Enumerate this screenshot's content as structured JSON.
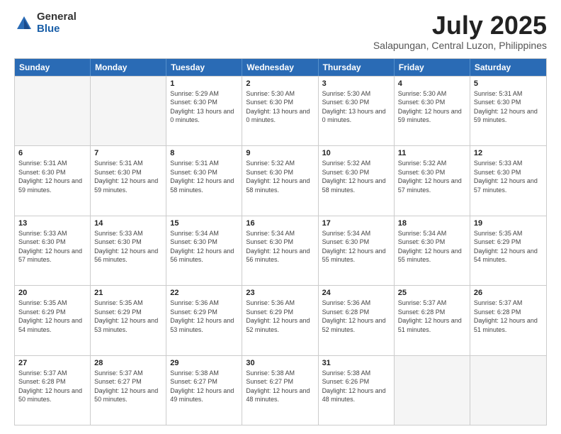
{
  "logo": {
    "general": "General",
    "blue": "Blue"
  },
  "title": "July 2025",
  "subtitle": "Salapungan, Central Luzon, Philippines",
  "weekdays": [
    "Sunday",
    "Monday",
    "Tuesday",
    "Wednesday",
    "Thursday",
    "Friday",
    "Saturday"
  ],
  "weeks": [
    [
      {
        "day": "",
        "empty": true
      },
      {
        "day": "",
        "empty": true
      },
      {
        "day": "1",
        "sunrise": "Sunrise: 5:29 AM",
        "sunset": "Sunset: 6:30 PM",
        "daylight": "Daylight: 13 hours and 0 minutes."
      },
      {
        "day": "2",
        "sunrise": "Sunrise: 5:30 AM",
        "sunset": "Sunset: 6:30 PM",
        "daylight": "Daylight: 13 hours and 0 minutes."
      },
      {
        "day": "3",
        "sunrise": "Sunrise: 5:30 AM",
        "sunset": "Sunset: 6:30 PM",
        "daylight": "Daylight: 13 hours and 0 minutes."
      },
      {
        "day": "4",
        "sunrise": "Sunrise: 5:30 AM",
        "sunset": "Sunset: 6:30 PM",
        "daylight": "Daylight: 12 hours and 59 minutes."
      },
      {
        "day": "5",
        "sunrise": "Sunrise: 5:31 AM",
        "sunset": "Sunset: 6:30 PM",
        "daylight": "Daylight: 12 hours and 59 minutes."
      }
    ],
    [
      {
        "day": "6",
        "sunrise": "Sunrise: 5:31 AM",
        "sunset": "Sunset: 6:30 PM",
        "daylight": "Daylight: 12 hours and 59 minutes."
      },
      {
        "day": "7",
        "sunrise": "Sunrise: 5:31 AM",
        "sunset": "Sunset: 6:30 PM",
        "daylight": "Daylight: 12 hours and 59 minutes."
      },
      {
        "day": "8",
        "sunrise": "Sunrise: 5:31 AM",
        "sunset": "Sunset: 6:30 PM",
        "daylight": "Daylight: 12 hours and 58 minutes."
      },
      {
        "day": "9",
        "sunrise": "Sunrise: 5:32 AM",
        "sunset": "Sunset: 6:30 PM",
        "daylight": "Daylight: 12 hours and 58 minutes."
      },
      {
        "day": "10",
        "sunrise": "Sunrise: 5:32 AM",
        "sunset": "Sunset: 6:30 PM",
        "daylight": "Daylight: 12 hours and 58 minutes."
      },
      {
        "day": "11",
        "sunrise": "Sunrise: 5:32 AM",
        "sunset": "Sunset: 6:30 PM",
        "daylight": "Daylight: 12 hours and 57 minutes."
      },
      {
        "day": "12",
        "sunrise": "Sunrise: 5:33 AM",
        "sunset": "Sunset: 6:30 PM",
        "daylight": "Daylight: 12 hours and 57 minutes."
      }
    ],
    [
      {
        "day": "13",
        "sunrise": "Sunrise: 5:33 AM",
        "sunset": "Sunset: 6:30 PM",
        "daylight": "Daylight: 12 hours and 57 minutes."
      },
      {
        "day": "14",
        "sunrise": "Sunrise: 5:33 AM",
        "sunset": "Sunset: 6:30 PM",
        "daylight": "Daylight: 12 hours and 56 minutes."
      },
      {
        "day": "15",
        "sunrise": "Sunrise: 5:34 AM",
        "sunset": "Sunset: 6:30 PM",
        "daylight": "Daylight: 12 hours and 56 minutes."
      },
      {
        "day": "16",
        "sunrise": "Sunrise: 5:34 AM",
        "sunset": "Sunset: 6:30 PM",
        "daylight": "Daylight: 12 hours and 56 minutes."
      },
      {
        "day": "17",
        "sunrise": "Sunrise: 5:34 AM",
        "sunset": "Sunset: 6:30 PM",
        "daylight": "Daylight: 12 hours and 55 minutes."
      },
      {
        "day": "18",
        "sunrise": "Sunrise: 5:34 AM",
        "sunset": "Sunset: 6:30 PM",
        "daylight": "Daylight: 12 hours and 55 minutes."
      },
      {
        "day": "19",
        "sunrise": "Sunrise: 5:35 AM",
        "sunset": "Sunset: 6:29 PM",
        "daylight": "Daylight: 12 hours and 54 minutes."
      }
    ],
    [
      {
        "day": "20",
        "sunrise": "Sunrise: 5:35 AM",
        "sunset": "Sunset: 6:29 PM",
        "daylight": "Daylight: 12 hours and 54 minutes."
      },
      {
        "day": "21",
        "sunrise": "Sunrise: 5:35 AM",
        "sunset": "Sunset: 6:29 PM",
        "daylight": "Daylight: 12 hours and 53 minutes."
      },
      {
        "day": "22",
        "sunrise": "Sunrise: 5:36 AM",
        "sunset": "Sunset: 6:29 PM",
        "daylight": "Daylight: 12 hours and 53 minutes."
      },
      {
        "day": "23",
        "sunrise": "Sunrise: 5:36 AM",
        "sunset": "Sunset: 6:29 PM",
        "daylight": "Daylight: 12 hours and 52 minutes."
      },
      {
        "day": "24",
        "sunrise": "Sunrise: 5:36 AM",
        "sunset": "Sunset: 6:28 PM",
        "daylight": "Daylight: 12 hours and 52 minutes."
      },
      {
        "day": "25",
        "sunrise": "Sunrise: 5:37 AM",
        "sunset": "Sunset: 6:28 PM",
        "daylight": "Daylight: 12 hours and 51 minutes."
      },
      {
        "day": "26",
        "sunrise": "Sunrise: 5:37 AM",
        "sunset": "Sunset: 6:28 PM",
        "daylight": "Daylight: 12 hours and 51 minutes."
      }
    ],
    [
      {
        "day": "27",
        "sunrise": "Sunrise: 5:37 AM",
        "sunset": "Sunset: 6:28 PM",
        "daylight": "Daylight: 12 hours and 50 minutes."
      },
      {
        "day": "28",
        "sunrise": "Sunrise: 5:37 AM",
        "sunset": "Sunset: 6:27 PM",
        "daylight": "Daylight: 12 hours and 50 minutes."
      },
      {
        "day": "29",
        "sunrise": "Sunrise: 5:38 AM",
        "sunset": "Sunset: 6:27 PM",
        "daylight": "Daylight: 12 hours and 49 minutes."
      },
      {
        "day": "30",
        "sunrise": "Sunrise: 5:38 AM",
        "sunset": "Sunset: 6:27 PM",
        "daylight": "Daylight: 12 hours and 48 minutes."
      },
      {
        "day": "31",
        "sunrise": "Sunrise: 5:38 AM",
        "sunset": "Sunset: 6:26 PM",
        "daylight": "Daylight: 12 hours and 48 minutes."
      },
      {
        "day": "",
        "empty": true
      },
      {
        "day": "",
        "empty": true
      }
    ]
  ]
}
